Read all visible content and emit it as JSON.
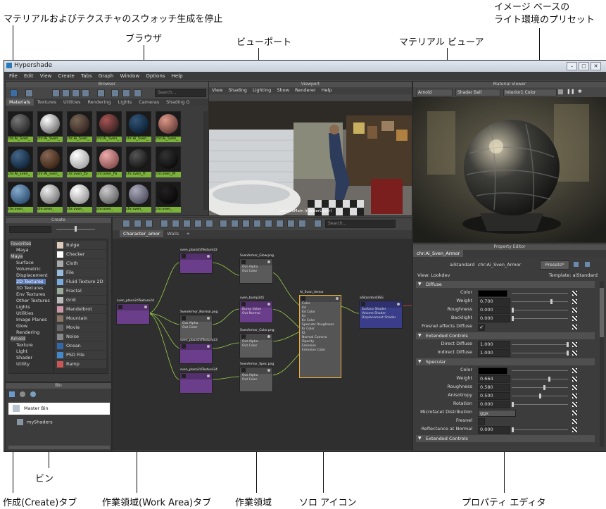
{
  "callouts": {
    "stop_swatch": "マテリアルおよびテクスチャのスウォッチ生成を停止",
    "browser": "ブラウザ",
    "viewport": "ビューポート",
    "material_viewer": "マテリアル ビューア",
    "ibl_preset": "イメージ ベースの\nライト環境のプリセット",
    "bin": "ビン",
    "create_tab": "作成(Create)タブ",
    "work_area_tab": "作業領域(Work Area)タブ",
    "work_area": "作業領域",
    "solo_icon": "ソロ アイコン",
    "property_editor": "プロパティ エディタ"
  },
  "app": {
    "title": "Hypershade",
    "menus": [
      "File",
      "Edit",
      "View",
      "Create",
      "Tabs",
      "Graph",
      "Window",
      "Options",
      "Help"
    ]
  },
  "browser": {
    "header": "Browser",
    "search_placeholder": "Search...",
    "tabs": [
      "Materials",
      "Textures",
      "Utilities",
      "Rendering",
      "Lights",
      "Cameras",
      "Shading G"
    ],
    "active_tab": "Materials",
    "swatches": [
      "chr:Ai_Sven_",
      "chr:Ai_Sven_",
      "chr:Ai_Sven_",
      "chr:Ai_Sven_",
      "chr:Ai_Sven_",
      "chr:Ai_Sven_",
      "chr:Ai_sven_",
      "chr:Ai_sven_",
      "chr:sven_Ey",
      "chr:sven_Fa",
      "chr:sven_H",
      "chr:sven_M",
      "chr:sven_",
      "chr:sven_",
      "chr:sven_",
      "chr:sven_",
      "chr:sven_",
      "chr:sven_"
    ]
  },
  "viewport": {
    "header": "Viewport",
    "menus": [
      "View",
      "Shading",
      "Lighting",
      "Show",
      "Renderer",
      "Help"
    ],
    "camera_label": "cameraMain (masterLayer)"
  },
  "material_viewer": {
    "header": "Material Viewer",
    "renderer": "Arnold",
    "geometry": "Shader Ball",
    "environment": "Interior1 Color"
  },
  "create": {
    "header": "Create",
    "categories": [
      "Favorites",
      "Maya",
      "Maya",
      "Surface",
      "Volumetric",
      "Displacement",
      "2D Textures",
      "3D Textures",
      "Env Textures",
      "Other Textures",
      "Lights",
      "Utilities",
      "Image Planes",
      "Glow",
      "Rendering",
      "Arnold",
      "Texture",
      "Light",
      "Shader",
      "Utility"
    ],
    "items": [
      "Bulge",
      "Checker",
      "Cloth",
      "File",
      "Fluid Texture 2D",
      "Fractal",
      "Grid",
      "Mandelbrot",
      "Mountain",
      "Movie",
      "Noise",
      "Ocean",
      "PSD File",
      "Ramp"
    ]
  },
  "bin": {
    "header": "Bin",
    "items": [
      "Master Bin",
      "myShaders"
    ]
  },
  "work_area": {
    "search_placeholder": "Search...",
    "tabs": [
      "Character_amor",
      "Walls",
      "+"
    ],
    "nodes": [
      {
        "name": "sven_place2dTexture24"
      },
      {
        "name": "sven_place2dTexture22"
      },
      {
        "name": "SvenArmor_Glow.png",
        "outs": [
          "Out Alpha",
          "Out Color"
        ]
      },
      {
        "name": "SvenArmor_Normal.png",
        "outs": [
          "Out Alpha",
          "Out Color"
        ]
      },
      {
        "name": "sven_bump2d1",
        "outs": [
          "Bump Value",
          "Out Normal"
        ]
      },
      {
        "name": "sven_place2dTexture23"
      },
      {
        "name": "SvenArmor_Color.png",
        "outs": [
          "Out Alpha",
          "Out Color"
        ]
      },
      {
        "name": "sven_place2dTexture24"
      },
      {
        "name": "SvenArmor_Spec.png",
        "outs": [
          "Out Alpha",
          "Out Color"
        ]
      },
      {
        "name": "Ai_Sven_Armor",
        "ports": [
          "Color",
          "Kd",
          "Kd Color",
          "Ks",
          "Ks Color",
          "Specular Roughness",
          "Kr Color",
          "Kt",
          "Normal Camera",
          "Opacity",
          "Emission",
          "Emission Color"
        ]
      },
      {
        "name": "aiStandard3SG",
        "ports": [
          "Surface Shader",
          "Volume Shader",
          "Displacement Shader"
        ]
      }
    ]
  },
  "property_editor": {
    "header": "Property Editor",
    "tab": "chr:Ai_Sven_Armor",
    "shader_type": "aiStandard",
    "shader_name": "chr:Ai_Sven_Armor",
    "presets_button": "Presets*",
    "view_label": "View: Lookdev",
    "template_label": "Template: aiStandard",
    "sections": [
      {
        "title": "Diffuse",
        "rows": [
          {
            "label": "Color",
            "type": "color",
            "color": "#000000"
          },
          {
            "label": "Weight",
            "value": "0.700",
            "frac": 0.7
          },
          {
            "label": "Roughness",
            "value": "0.000",
            "frac": 0.0
          },
          {
            "label": "Backlight",
            "value": "0.000",
            "frac": 0.0
          },
          {
            "label": "Fresnel affects Diffuse",
            "type": "check",
            "checked": true
          }
        ]
      },
      {
        "title": "Extended Controls",
        "rows": [
          {
            "label": "Direct Diffuse",
            "value": "1.000",
            "frac": 1.0
          },
          {
            "label": "Indirect Diffuse",
            "value": "1.000",
            "frac": 1.0
          }
        ]
      },
      {
        "title": "Specular",
        "rows": [
          {
            "label": "Color",
            "type": "color",
            "color": "#000000"
          },
          {
            "label": "Weight",
            "value": "0.664",
            "frac": 0.664
          },
          {
            "label": "Roughness",
            "value": "0.580",
            "frac": 0.58
          },
          {
            "label": "Anisotropy",
            "value": "0.500",
            "frac": 0.5
          },
          {
            "label": "Rotation",
            "value": "0.000",
            "frac": 0.0
          },
          {
            "label": "Microfacet Distribution",
            "type": "select",
            "value": "ggx"
          },
          {
            "label": "Fresnel",
            "type": "check",
            "checked": false
          },
          {
            "label": "Reflectance at Normal",
            "value": "0.000",
            "frac": 0.0
          }
        ]
      },
      {
        "title": "Extended Controls",
        "rows": []
      }
    ]
  }
}
